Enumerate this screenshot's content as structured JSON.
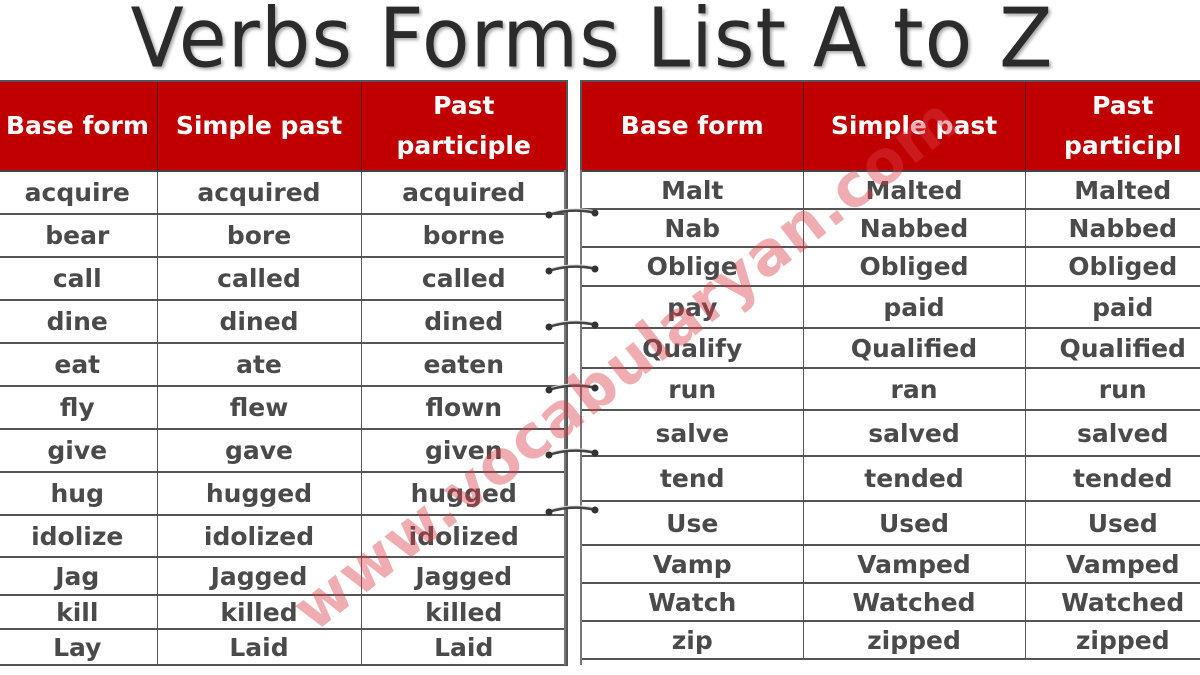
{
  "title": "Verbs Forms List A to Z",
  "watermark": "www.vocabularyan.com",
  "colors": {
    "header_bg": "#c00000",
    "header_text": "#ffffff",
    "cell_text": "#4a4a4a",
    "watermark": "#e06870"
  },
  "left_table": {
    "headers": [
      "Base form",
      "Simple past",
      "Past participle"
    ],
    "header_lines": {
      "base": "Base form",
      "simple": "Simple past",
      "pp_line1": "Past",
      "pp_line2": "participle"
    },
    "rows": [
      [
        "acquire",
        "acquired",
        "acquired"
      ],
      [
        "bear",
        "bore",
        "borne"
      ],
      [
        "call",
        "called",
        "called"
      ],
      [
        "dine",
        "dined",
        "dined"
      ],
      [
        "eat",
        "ate",
        "eaten"
      ],
      [
        "fly",
        "flew",
        "flown"
      ],
      [
        "give",
        "gave",
        "given"
      ],
      [
        "hug",
        "hugged",
        "hugged"
      ],
      [
        "idolize",
        "idolized",
        "idolized"
      ],
      [
        "Jag",
        "Jagged",
        "Jagged"
      ],
      [
        "kill",
        "killed",
        "killed"
      ],
      [
        "Lay",
        "Laid",
        "Laid"
      ]
    ]
  },
  "right_table": {
    "headers": [
      "Base form",
      "Simple past",
      "Past participle"
    ],
    "header_lines": {
      "base": "Base form",
      "simple": "Simple past",
      "pp_line1": "Past",
      "pp_line2": "participl"
    },
    "rows": [
      [
        "Malt",
        "Malted",
        "Malted"
      ],
      [
        "Nab",
        "Nabbed",
        "Nabbed"
      ],
      [
        "Oblige",
        "Obliged",
        "Obliged"
      ],
      [
        "pay",
        "paid",
        "paid"
      ],
      [
        "Qualify",
        "Qualified",
        "Qualified"
      ],
      [
        "run",
        "ran",
        "run"
      ],
      [
        "salve",
        "salved",
        "salved"
      ],
      [
        "tend",
        "tended",
        "tended"
      ],
      [
        "Use",
        "Used",
        "Used"
      ],
      [
        "Vamp",
        "Vamped",
        "Vamped"
      ],
      [
        "Watch",
        "Watched",
        "Watched"
      ],
      [
        "zip",
        "zipped",
        "zipped"
      ]
    ]
  }
}
